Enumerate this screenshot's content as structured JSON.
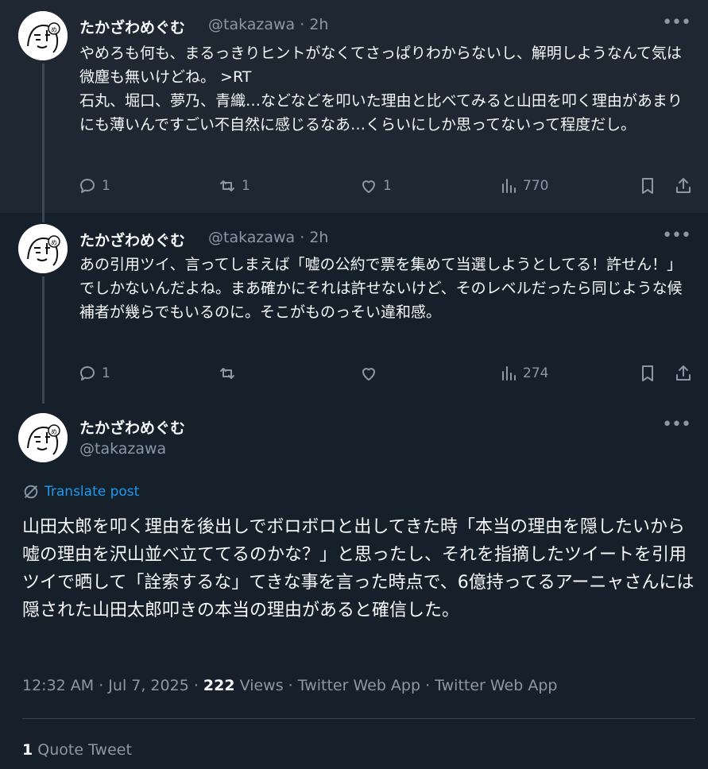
{
  "tweets": [
    {
      "name": "たかざわめぐむ",
      "handle": "@takazawa · 2h",
      "text": "やめろも何も、まるっきりヒントがなくてさっぱりわからないし、解明しようなんて気は微塵も無いけどね。 >RT\n石丸、堀口、夢乃、青織…などなどを叩いた理由と比べてみると山田を叩く理由があまりにも薄いんですごい不自然に感じるなあ…くらいにしか思ってないって程度だし。",
      "replies": "1",
      "retweets": "1",
      "likes": "1",
      "views": "770"
    },
    {
      "name": "たかざわめぐむ",
      "handle": "@takazawa · 2h",
      "text": "あの引用ツイ、言ってしまえば「嘘の公約で票を集めて当選しようとしてる！許せん！」でしかないんだよね。まあ確かにそれは許せないけど、そのレベルだったら同じような候補者が幾らでもいるのに。そこがものっそい違和感。",
      "replies": "1",
      "retweets": "",
      "likes": "",
      "views": "274"
    }
  ],
  "main": {
    "name": "たかざわめぐむ",
    "handle": "@takazawa",
    "translate": "Translate post",
    "text": "山田太郎を叩く理由を後出しでボロボロと出してきた時「本当の理由を隠したいから嘘の理由を沢山並べ立ててるのかな？」と思ったし、それを指摘したツイートを引用ツイで晒して「詮索するな」てきな事を言った時点で、6億持ってるアーニャさんには隠された山田太郎叩きの本当の理由があると確信した。",
    "time": "12:32 AM · Jul 7, 2025 · ",
    "views_count": "222",
    "views_rest": " Views · Twitter Web App · Twitter Web App",
    "quote_count": "1",
    "quote_label": " Quote Tweet"
  },
  "icons": [
    "reply-icon",
    "retweet-icon",
    "like-icon",
    "views-icon",
    "bookmark-icon",
    "share-icon",
    "more-icon",
    "translate-icon"
  ],
  "colors": {
    "background": "#15202b",
    "hover": "#1e2732",
    "muted": "#8b98a5",
    "link": "#1d9bf0"
  }
}
